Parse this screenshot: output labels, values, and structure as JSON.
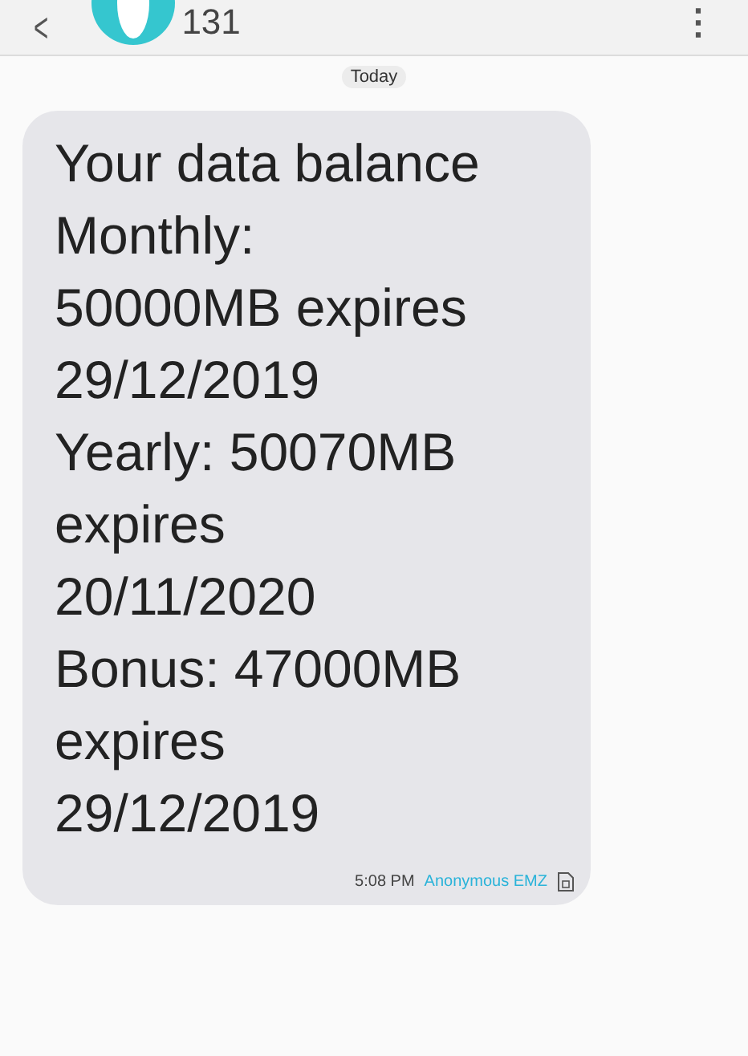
{
  "header": {
    "back": "<",
    "title": "131",
    "menu": "⋮"
  },
  "date_chip": "Today",
  "message": {
    "lines": [
      "Your data balance",
      "Monthly:",
      "50000MB expires",
      "29/12/2019",
      "Yearly: 50070MB",
      "expires",
      "20/11/2020",
      "Bonus: 47000MB",
      "expires",
      "29/12/2019"
    ],
    "time": "5:08 PM",
    "sim": "Anonymous EMZ"
  }
}
